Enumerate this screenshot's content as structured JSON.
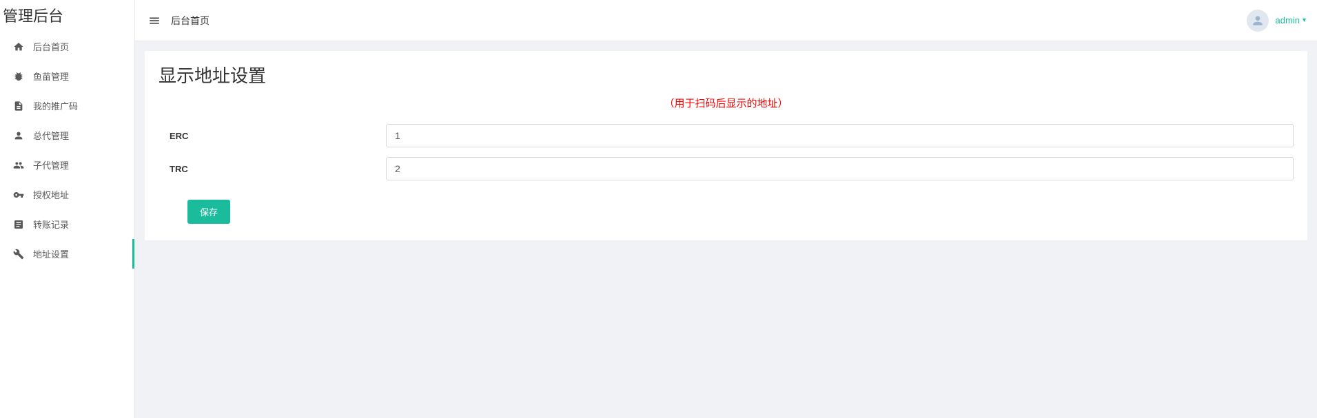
{
  "app": {
    "title": "管理后台"
  },
  "sidebar": {
    "items": [
      {
        "label": "后台首页",
        "active": false
      },
      {
        "label": "鱼苗管理",
        "active": false
      },
      {
        "label": "我的推广码",
        "active": false
      },
      {
        "label": "总代管理",
        "active": false
      },
      {
        "label": "子代管理",
        "active": false
      },
      {
        "label": "授权地址",
        "active": false
      },
      {
        "label": "转账记录",
        "active": false
      },
      {
        "label": "地址设置",
        "active": true
      }
    ]
  },
  "topbar": {
    "breadcrumb": "后台首页",
    "user": "admin"
  },
  "page": {
    "title": "显示地址设置",
    "notice": "（用于扫码后显示的地址）",
    "fields": {
      "erc": {
        "label": "ERC",
        "value": "1"
      },
      "trc": {
        "label": "TRC",
        "value": "2"
      }
    },
    "save_label": "保存"
  }
}
